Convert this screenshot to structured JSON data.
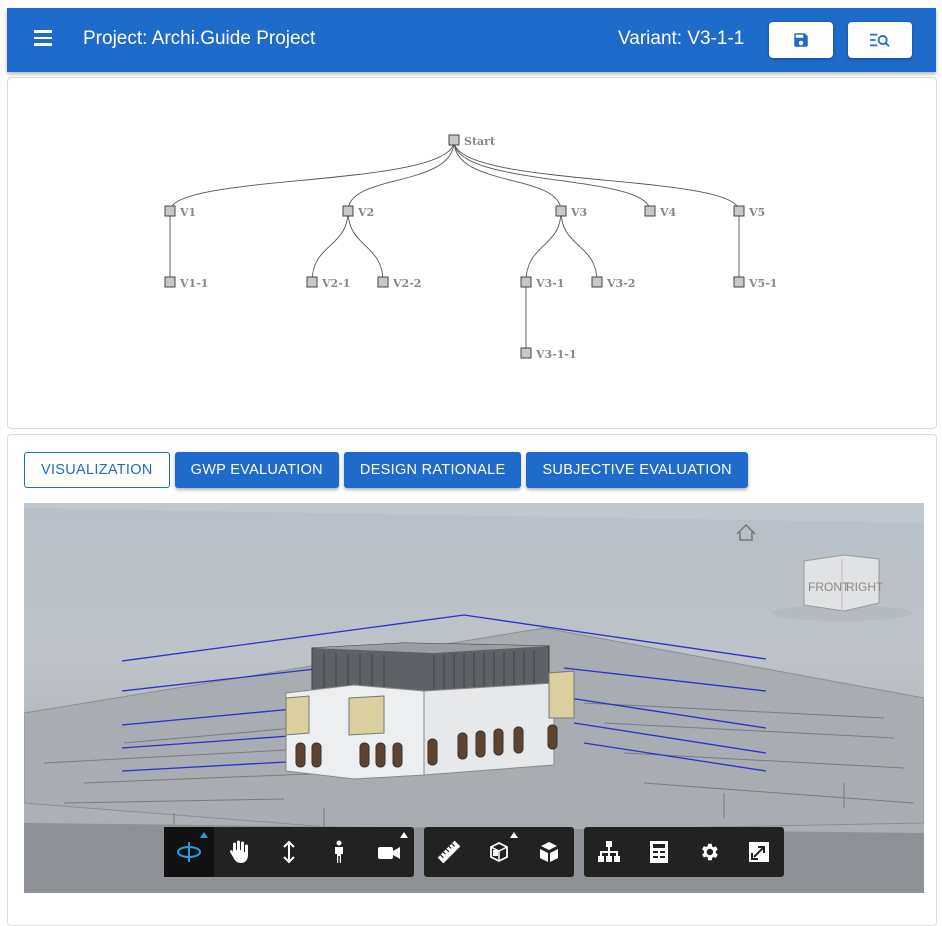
{
  "appbar": {
    "project_title": "Project: Archi.Guide Project",
    "variant_label": "Variant: V3-1-1",
    "menu_icon": "hamburger-menu-icon",
    "save_icon": "save-icon",
    "search_list_icon": "search-list-icon"
  },
  "tree": {
    "nodes": [
      "Start",
      "V1",
      "V2",
      "V3",
      "V4",
      "V5",
      "V1-1",
      "V2-1",
      "V2-2",
      "V3-1",
      "V3-2",
      "V5-1",
      "V3-1-1"
    ]
  },
  "tabs": [
    "VISUALIZATION",
    "GWP EVALUATION",
    "DESIGN RATIONALE",
    "SUBJECTIVE EVALUATION"
  ],
  "viewer": {
    "viewcube_front": "FRONT",
    "viewcube_right": "RIGHT",
    "home_icon": "home-icon",
    "toolbar": {
      "navigation": [
        "orbit-icon",
        "pan-icon",
        "zoom-icon",
        "first-person-icon",
        "camera-icon"
      ],
      "analysis": [
        "measure-icon",
        "section-icon",
        "explode-icon"
      ],
      "settings": [
        "model-browser-icon",
        "properties-icon",
        "settings-icon",
        "fullscreen-icon"
      ]
    }
  },
  "colors": {
    "primary": "#1e6bcb",
    "toolbar_bg": "#222222",
    "active_tool": "#2a9be0"
  }
}
